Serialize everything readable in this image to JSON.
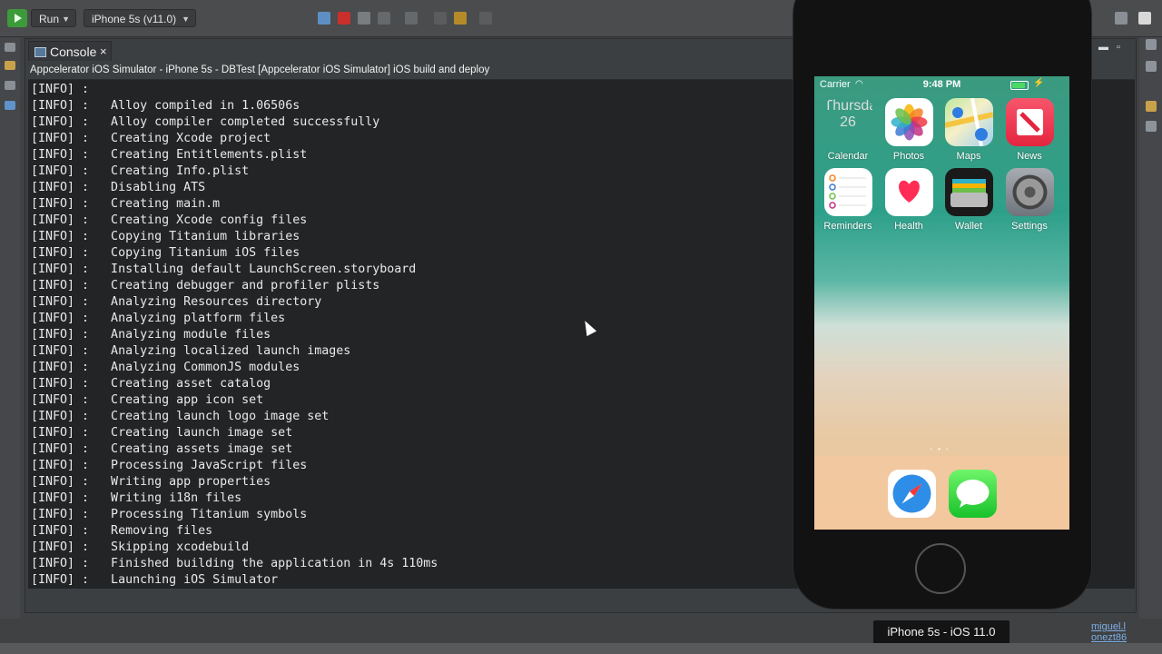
{
  "toolbar": {
    "run_label": "Run",
    "device_label": "iPhone 5s (v11.0)"
  },
  "console": {
    "tab_label": "Console",
    "close_glyph": "×",
    "title": "Appcelerator iOS Simulator - iPhone 5s - DBTest [Appcelerator iOS Simulator] iOS build and deploy",
    "lines": [
      "[INFO] :",
      "[INFO] :   Alloy compiled in 1.06506s",
      "[INFO] :   Alloy compiler completed successfully",
      "[INFO] :   Creating Xcode project",
      "[INFO] :   Creating Entitlements.plist",
      "[INFO] :   Creating Info.plist",
      "[INFO] :   Disabling ATS",
      "[INFO] :   Creating main.m",
      "[INFO] :   Creating Xcode config files",
      "[INFO] :   Copying Titanium libraries",
      "[INFO] :   Copying Titanium iOS files",
      "[INFO] :   Installing default LaunchScreen.storyboard",
      "[INFO] :   Creating debugger and profiler plists",
      "[INFO] :   Analyzing Resources directory",
      "[INFO] :   Analyzing platform files",
      "[INFO] :   Analyzing module files",
      "[INFO] :   Analyzing localized launch images",
      "[INFO] :   Analyzing CommonJS modules",
      "[INFO] :   Creating asset catalog",
      "[INFO] :   Creating app icon set",
      "[INFO] :   Creating launch logo image set",
      "[INFO] :   Creating launch image set",
      "[INFO] :   Creating assets image set",
      "[INFO] :   Processing JavaScript files",
      "[INFO] :   Writing app properties",
      "[INFO] :   Writing i18n files",
      "[INFO] :   Processing Titanium symbols",
      "[INFO] :   Removing files",
      "[INFO] :   Skipping xcodebuild",
      "[INFO] :   Finished building the application in 4s 110ms",
      "[INFO] :   Launching iOS Simulator"
    ]
  },
  "simulator": {
    "carrier": "Carrier",
    "time": "9:48 PM",
    "calendar_weekday": "Thursday",
    "calendar_day": "26",
    "apps": [
      {
        "label": "Calendar",
        "icon": "calendar-icon"
      },
      {
        "label": "Photos",
        "icon": "photos-icon"
      },
      {
        "label": "Maps",
        "icon": "maps-icon"
      },
      {
        "label": "News",
        "icon": "news-icon"
      },
      {
        "label": "Reminders",
        "icon": "reminders-icon"
      },
      {
        "label": "Health",
        "icon": "health-icon"
      },
      {
        "label": "Wallet",
        "icon": "wallet-icon"
      },
      {
        "label": "Settings",
        "icon": "settings-icon"
      }
    ],
    "dock": [
      {
        "icon": "safari-icon"
      },
      {
        "icon": "messages-icon"
      }
    ],
    "page_indicator": {
      "pages": 3,
      "current": 2
    },
    "device_label": "iPhone 5s - iOS 11.0"
  },
  "side_link": {
    "line1": "miguel.l",
    "line2": "onezt86"
  },
  "colors": {
    "run_green": "#3d9a3a",
    "console_bg": "#222426",
    "battery_green": "#4cd964"
  }
}
